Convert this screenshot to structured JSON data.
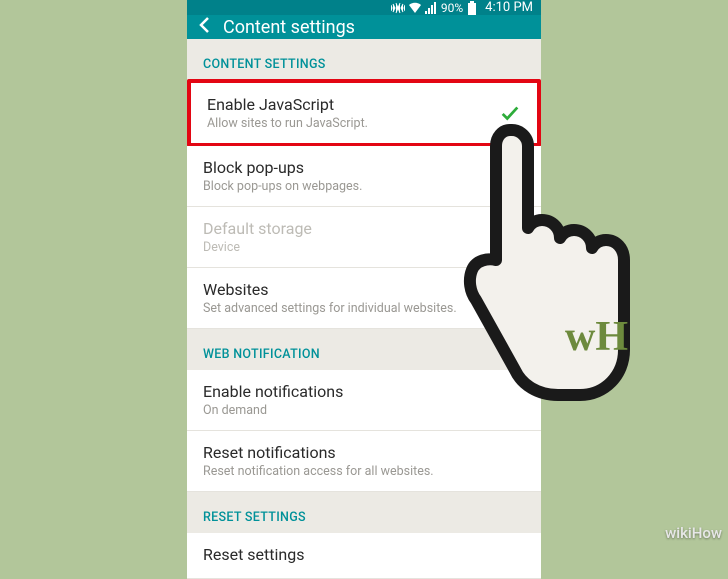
{
  "status": {
    "battery_pct": "90%",
    "time": "4:10 PM"
  },
  "header": {
    "title": "Content settings"
  },
  "sections": {
    "content_settings": {
      "header": "CONTENT SETTINGS",
      "items": {
        "enable_js": {
          "title": "Enable JavaScript",
          "sub": "Allow sites to run JavaScript.",
          "checked": true
        },
        "block_popups": {
          "title": "Block pop-ups",
          "sub": "Block pop-ups on webpages.",
          "checked": true
        },
        "default_storage": {
          "title": "Default storage",
          "sub": "Device",
          "disabled": true
        },
        "websites": {
          "title": "Websites",
          "sub": "Set advanced settings for individual websites."
        }
      }
    },
    "web_notification": {
      "header": "WEB NOTIFICATION",
      "items": {
        "enable_notifications": {
          "title": "Enable notifications",
          "sub": "On demand"
        },
        "reset_notifications": {
          "title": "Reset notifications",
          "sub": "Reset notification access for all websites."
        }
      }
    },
    "reset_settings": {
      "header": "RESET SETTINGS",
      "items": {
        "reset_settings": {
          "title": "Reset settings",
          "sub": ""
        }
      }
    }
  },
  "watermark": "wikiHow",
  "pointer_logo": "wH"
}
